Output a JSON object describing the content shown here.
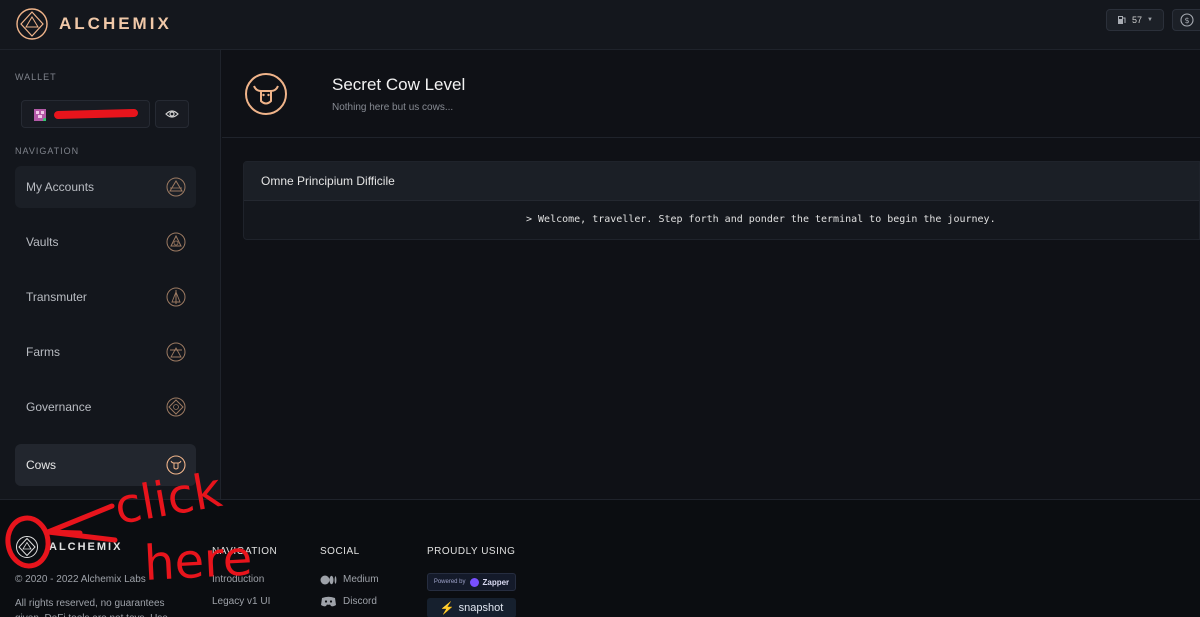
{
  "topbar": {
    "brand": "ALCHEMIX",
    "gas_value": "57"
  },
  "sidebar": {
    "wallet_label": "WALLET",
    "navigation_label": "NAVIGATION",
    "items": [
      {
        "label": "My Accounts"
      },
      {
        "label": "Vaults"
      },
      {
        "label": "Transmuter"
      },
      {
        "label": "Farms"
      },
      {
        "label": "Governance"
      },
      {
        "label": "Cows"
      }
    ]
  },
  "header": {
    "title": "Secret Cow Level",
    "subtitle": "Nothing here but us cows..."
  },
  "card": {
    "title": "Omne Principium Difficile",
    "terminal_line": "> Welcome, traveller. Step forth and ponder the terminal to begin the journey."
  },
  "footer": {
    "brand": "ALCHEMIX",
    "copyright": "© 2020 - 2022 Alchemix Labs",
    "rights": "All rights reserved, no guarantees given. DeFi tools are not toys. Use",
    "navigation_heading": "NAVIGATION",
    "navigation_links": [
      "Introduction",
      "Legacy v1 UI"
    ],
    "social_heading": "SOCIAL",
    "social_links": [
      "Medium",
      "Discord"
    ],
    "proudly_using_heading": "PROUDLY USING",
    "zapper_prefix": "Powered by",
    "zapper_name": "Zapper",
    "snapshot_name": "snapshot"
  },
  "annotation": {
    "text_line1": "click",
    "text_line2": "here",
    "color": "#e8141c"
  },
  "colors": {
    "accent": "#f0b48a",
    "background": "#0f1116",
    "sidebar": "#13161c"
  }
}
